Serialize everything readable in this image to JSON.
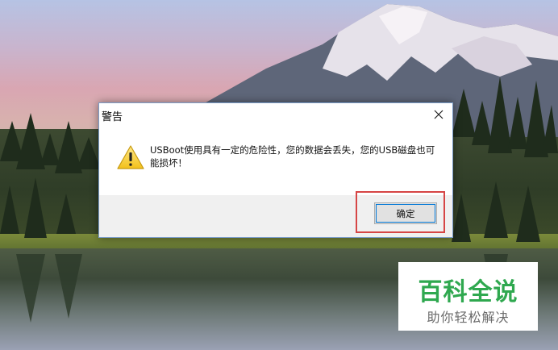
{
  "dialog": {
    "title": "警告",
    "message": "USBoot使用具有一定的危险性，您的数据会丢失，您的USB磁盘也可能损坏！",
    "ok_label": "确定",
    "close_icon": "close-icon",
    "warning_icon": "warning-icon"
  },
  "watermark": {
    "title": "百科全说",
    "subtitle": "助你轻松解决"
  },
  "colors": {
    "dialog_border": "#7a9cc7",
    "footer_bg": "#f0f0f0",
    "button_focus": "#0078d7",
    "highlight": "#d64545",
    "watermark_green": "#2fa84f"
  }
}
